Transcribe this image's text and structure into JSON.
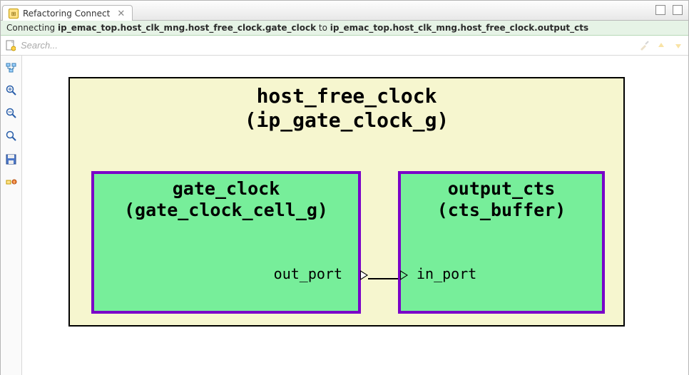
{
  "tab": {
    "title": "Refactoring Connect"
  },
  "infobar": {
    "prefix": "Connecting ",
    "from": "ip_emac_top.host_clk_mng.host_free_clock.gate_clock",
    "mid": " to ",
    "to": "ip_emac_top.host_clk_mng.host_free_clock.output_cts"
  },
  "search": {
    "placeholder": "Search..."
  },
  "diagram": {
    "outer_name": "host_free_clock",
    "outer_type": "(ip_gate_clock_g)",
    "left_name": "gate_clock",
    "left_type": "(gate_clock_cell_g)",
    "left_port": "out_port",
    "right_name": "output_cts",
    "right_type": "(cts_buffer)",
    "right_port": "in_port"
  },
  "icons": {
    "tab": "refactor-icon",
    "new": "new-page-icon",
    "tree": "tree-icon",
    "zoom_in": "zoom-in-icon",
    "zoom_out": "zoom-out-icon",
    "zoom_reset": "zoom-reset-icon",
    "save": "save-icon",
    "breakpoint": "breakpoint-icon",
    "broom": "broom-icon",
    "arrow_up": "arrow-up-icon",
    "arrow_down": "arrow-down-icon"
  }
}
